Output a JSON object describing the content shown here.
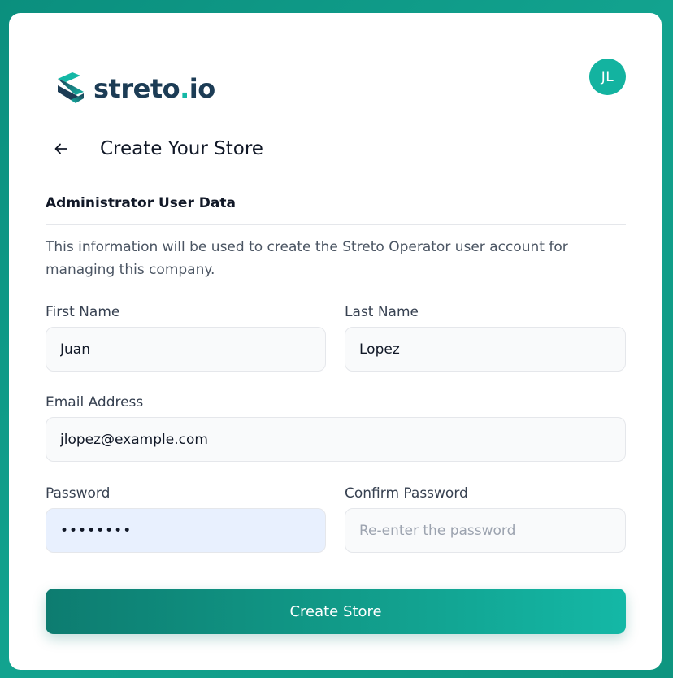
{
  "brand": {
    "name": "streto",
    "dot": ".",
    "tld": "io",
    "accent_color": "#14b8a6",
    "text_color": "#1c3c55"
  },
  "user": {
    "initials": "JL",
    "avatar_color": "#13b3a0"
  },
  "header": {
    "back_icon": "arrow-left-icon",
    "title": "Create Your Store"
  },
  "section": {
    "title": "Administrator User Data",
    "description": "This information will be used to create the Streto Operator user account for managing this company."
  },
  "form": {
    "first_name": {
      "label": "First Name",
      "value": "Juan",
      "placeholder": ""
    },
    "last_name": {
      "label": "Last Name",
      "value": "Lopez",
      "placeholder": ""
    },
    "email": {
      "label": "Email Address",
      "value": "jlopez@example.com",
      "placeholder": ""
    },
    "password": {
      "label": "Password",
      "value": "password",
      "placeholder": ""
    },
    "confirm_password": {
      "label": "Confirm Password",
      "value": "",
      "placeholder": "Re-enter the password"
    },
    "submit_label": "Create Store"
  }
}
